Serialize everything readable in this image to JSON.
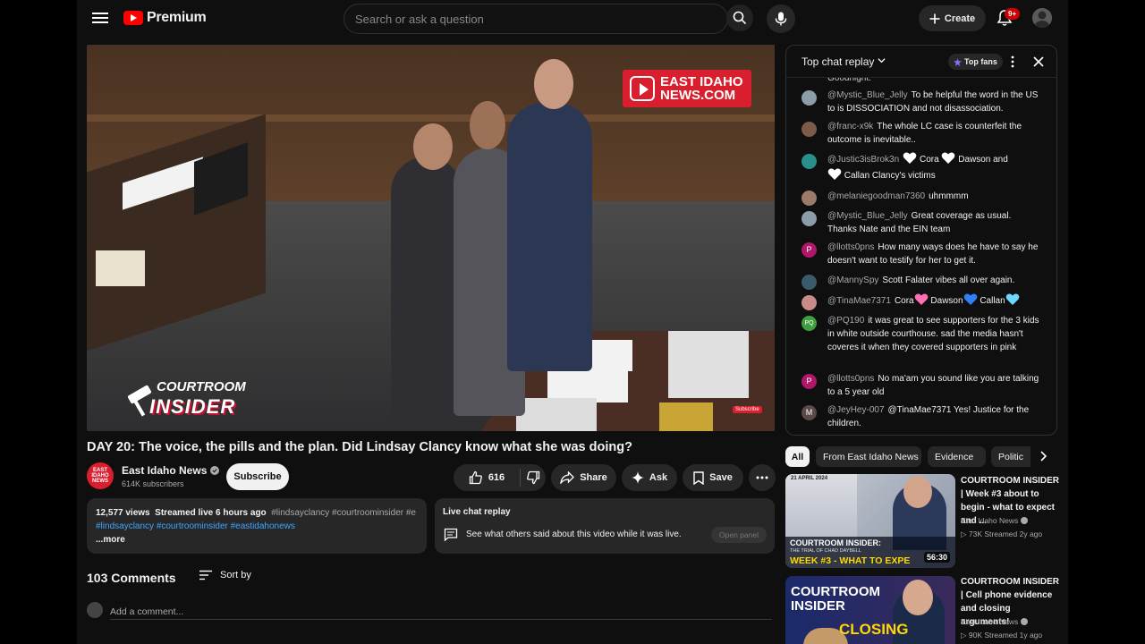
{
  "header": {
    "logo_text": "Premium",
    "search_placeholder": "Search or ask a question",
    "create_label": "Create",
    "notification_badge": "9+"
  },
  "video": {
    "overlay_logo_line1": "EAST IDAHO",
    "overlay_logo_line2": "NEWS.COM",
    "brand_line1": "COURTROOM",
    "brand_line2": "INSIDER",
    "subscribe_watermark": "Subscribe",
    "title": "DAY 20: The voice, the pills and the plan. Did Lindsay Clancy know what she was doing?"
  },
  "channel": {
    "avatar_text": "EAST IDAHO NEWS",
    "name": "East Idaho News",
    "subscribers": "614K subscribers",
    "subscribe_label": "Subscribe"
  },
  "actions": {
    "likes": "616",
    "share": "Share",
    "ask": "Ask",
    "save": "Save"
  },
  "description": {
    "views": "12,577 views",
    "streamed": "Streamed live 6 hours ago",
    "tags_line1": "#lindsayclancy #courtroominsider #e",
    "links_line2": "#lindsayclancy #courtroominsider #eastidahonews",
    "more": "...more"
  },
  "live_replay": {
    "title": "Live chat replay",
    "text": "See what others said about this video while it was live.",
    "open_panel": "Open panel"
  },
  "comments": {
    "count": "103 Comments",
    "sort_label": "Sort by",
    "add_placeholder": "Add a comment..."
  },
  "chat": {
    "title": "Top chat replay",
    "top_fans": "Top fans",
    "partial_text": "Goodnight.",
    "messages": [
      {
        "author": "@Mystic_Blue_Jelly",
        "text": "To be helpful the word in the US to is DISSOCIATION and not disassociation.",
        "avatar_color": "#8a9da8"
      },
      {
        "author": "@franc-x9k",
        "text": "The whole LC case is counterfeit the outcome is inevitable..",
        "avatar_color": "#7b5b4a"
      },
      {
        "author": "@Justic3isBrok3n",
        "t1": "Cora",
        "t2": "Dawson and",
        "t3": "Callan Clancy's victims",
        "avatar_color": "#2a8f8a"
      },
      {
        "author": "@melaniegoodman7360",
        "text": "uhmmmm",
        "avatar_color": "#9b7a6a"
      },
      {
        "author": "@Mystic_Blue_Jelly",
        "text": "Great coverage as usual. Thanks Nate and the EIN team",
        "avatar_color": "#8a9da8"
      },
      {
        "author": "@llotts0pns",
        "text": "How many ways does he have to say he doesn't want to testify for her to get it.",
        "avatar_letter": "P",
        "avatar_color": "#b0176b"
      },
      {
        "author": "@MannySpy",
        "text": "Scott Falater vibes all over again.",
        "avatar_color": "#3a5b6b"
      },
      {
        "author": "@TinaMae7371",
        "t1": "Cora",
        "t2": "Dawson",
        "t3": "Callan",
        "avatar_color": "#c98a8a"
      },
      {
        "author": "@PQ190",
        "text": "it was great to see supporters for the 3 kids in white outside courthouse. sad the media hasn't coveres it when they covered supporters in pink",
        "avatar_letter": "PQ",
        "avatar_color": "#3f9e3f"
      },
      {
        "author": "@llotts0pns",
        "text": "No ma'am you sound like you are talking to a 5 year old",
        "avatar_letter": "P",
        "avatar_color": "#b0176b"
      },
      {
        "author": "@JeyHey-007",
        "text": "@TinaMae7371 Yes! Justice for the children.",
        "avatar_letter": "M",
        "avatar_color": "#5a4a4a"
      }
    ]
  },
  "chips": [
    "All",
    "From East Idaho News",
    "Evidence",
    "Politic"
  ],
  "recommendations": [
    {
      "title": "COURTROOM INSIDER | Week #3 about to begin - what to expect and ...",
      "channel": "East Idaho News",
      "meta": "73K  Streamed 2y ago",
      "duration": "56:30",
      "thumb_date": "21 APRIL 2024",
      "thumb_line1": "COURTROOM INSIDER:",
      "thumb_line2": "THE TRIAL OF CHAD DAYBELL",
      "thumb_line3": "WEEK #3 - WHAT TO EXPE"
    },
    {
      "title": "COURTROOM INSIDER | Cell phone evidence and closing arguments!",
      "channel": "East Idaho News",
      "meta": "90K  Streamed 1y ago",
      "thumb_line1": "COURTROOM",
      "thumb_line2": "INSIDER",
      "thumb_line3": "CLOSING"
    }
  ],
  "colors": {
    "background": "#0f0f0f",
    "surface": "#272727",
    "brand_red": "#ff0000",
    "link_blue": "#3ea6ff"
  }
}
